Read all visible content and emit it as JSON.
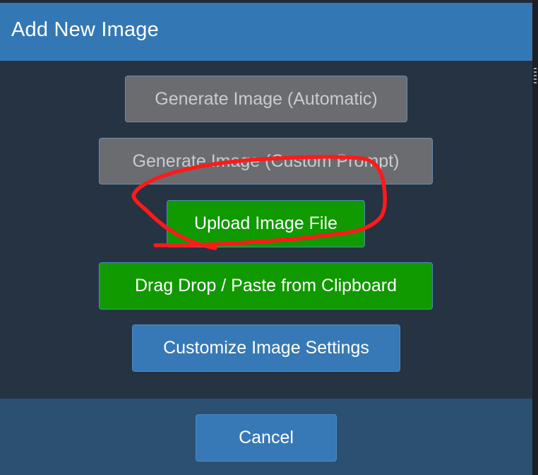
{
  "dialog": {
    "title": "Add New Image"
  },
  "buttons": {
    "generate_automatic": "Generate Image (Automatic)",
    "generate_custom": "Generate Image (Custom Prompt)",
    "upload_file": "Upload Image File",
    "drag_drop": "Drag Drop / Paste from Clipboard",
    "customize_settings": "Customize Image Settings"
  },
  "footer": {
    "cancel_label": "Cancel"
  },
  "colors": {
    "header": "#3378b5",
    "body": "#263343",
    "footer": "#2b5072",
    "disabled_button": "#6a6c70",
    "success_button": "#119900",
    "primary_button": "#3779b6",
    "annotation": "#ff1a1a"
  }
}
